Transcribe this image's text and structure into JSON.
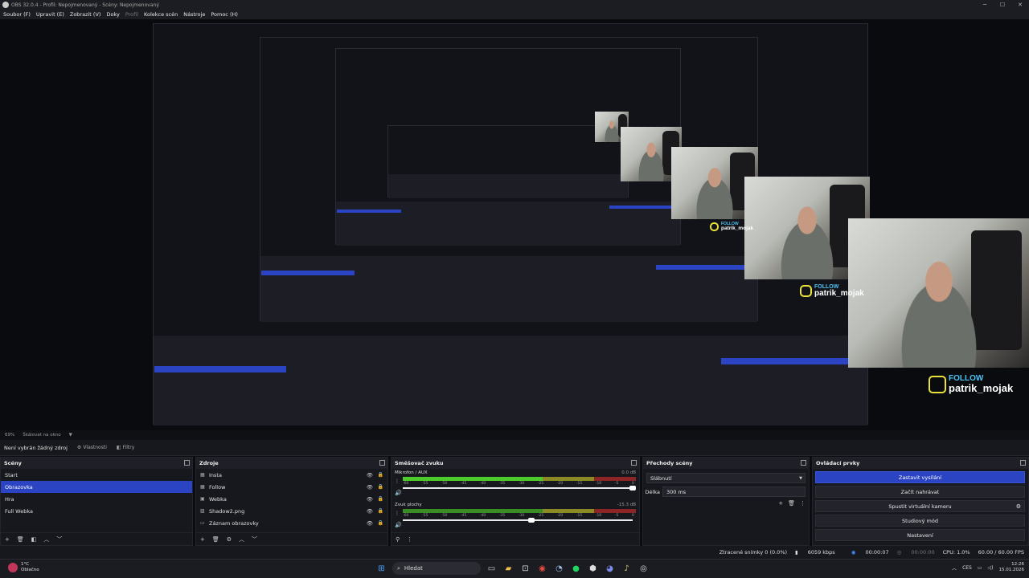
{
  "window": {
    "title": "OBS 32.0.4 - Profil: Nepojmenovaný - Scény: Nepojmenovaný",
    "controls": [
      "─",
      "☐",
      "✕"
    ]
  },
  "menu": [
    {
      "label": "Soubor (F)",
      "dim": false
    },
    {
      "label": "Upravit (E)",
      "dim": false
    },
    {
      "label": "Zobrazit (V)",
      "dim": false
    },
    {
      "label": "Doky",
      "dim": false
    },
    {
      "label": "Profil",
      "dim": true
    },
    {
      "label": "Kolekce scén",
      "dim": false
    },
    {
      "label": "Nástroje",
      "dim": false
    },
    {
      "label": "Pomoc (H)",
      "dim": false
    }
  ],
  "preview": {
    "follow_word": "FOLLOW",
    "handle": "patrik_mojak"
  },
  "zoombar": {
    "zoom": "69%",
    "scale_mode": "Škálovat na okno"
  },
  "propbar": {
    "no_source": "Není vybrán žádný zdroj",
    "properties": "Vlastnosti",
    "filters": "Filtry"
  },
  "scenes": {
    "title": "Scény",
    "items": [
      {
        "label": "Start",
        "selected": false
      },
      {
        "label": "Obrazovka",
        "selected": true
      },
      {
        "label": "Hra",
        "selected": false
      },
      {
        "label": "Full Webka",
        "selected": false
      }
    ]
  },
  "sources": {
    "title": "Zdroje",
    "items": [
      {
        "label": "Insta",
        "icon": "▦"
      },
      {
        "label": "Follow",
        "icon": "▦"
      },
      {
        "label": "Webka",
        "icon": "▣"
      },
      {
        "label": "Shadow2.png",
        "icon": "▨"
      },
      {
        "label": "Záznam obrazovky",
        "icon": "▭"
      }
    ]
  },
  "mixer": {
    "title": "Směšovač zvuku",
    "ticks": [
      "-60",
      "-55",
      "-50",
      "-45",
      "-40",
      "-35",
      "-30",
      "-25",
      "-20",
      "-15",
      "-10",
      "-5",
      "0"
    ],
    "channels": [
      {
        "name": "Mikrofon / AUX",
        "db": "0.0 dB",
        "level": 0.18,
        "volume": 1.0
      },
      {
        "name": "Zvuk plochy",
        "db": "-15.3 dB",
        "level": 0.0,
        "volume": 0.56
      }
    ]
  },
  "transitions": {
    "title": "Přechody scény",
    "type": "Slábnutí",
    "duration_label": "Délka",
    "duration": "300 ms"
  },
  "controls": {
    "title": "Ovládací prvky",
    "buttons": [
      {
        "label": "Zastavit vysílání",
        "primary": true
      },
      {
        "label": "Začít nahrávat",
        "primary": false
      },
      {
        "label": "Spustit virtuální kameru",
        "primary": false
      },
      {
        "label": "Studiový mód",
        "primary": false
      },
      {
        "label": "Nastavení",
        "primary": false
      }
    ]
  },
  "status": {
    "dropped": "Ztracené snímky 0 (0.0%)",
    "bitrate": "6059 kbps",
    "stream_time": "00:00:07",
    "rec_time": "00:00:00",
    "cpu": "CPU: 1.0%",
    "fps": "60.00 / 60.00 FPS"
  },
  "taskbar": {
    "temp": "1°C",
    "weather": "Oblačno",
    "search": "Hledat",
    "lang": "CES",
    "time": "12:26",
    "date": "15.01.2026"
  }
}
